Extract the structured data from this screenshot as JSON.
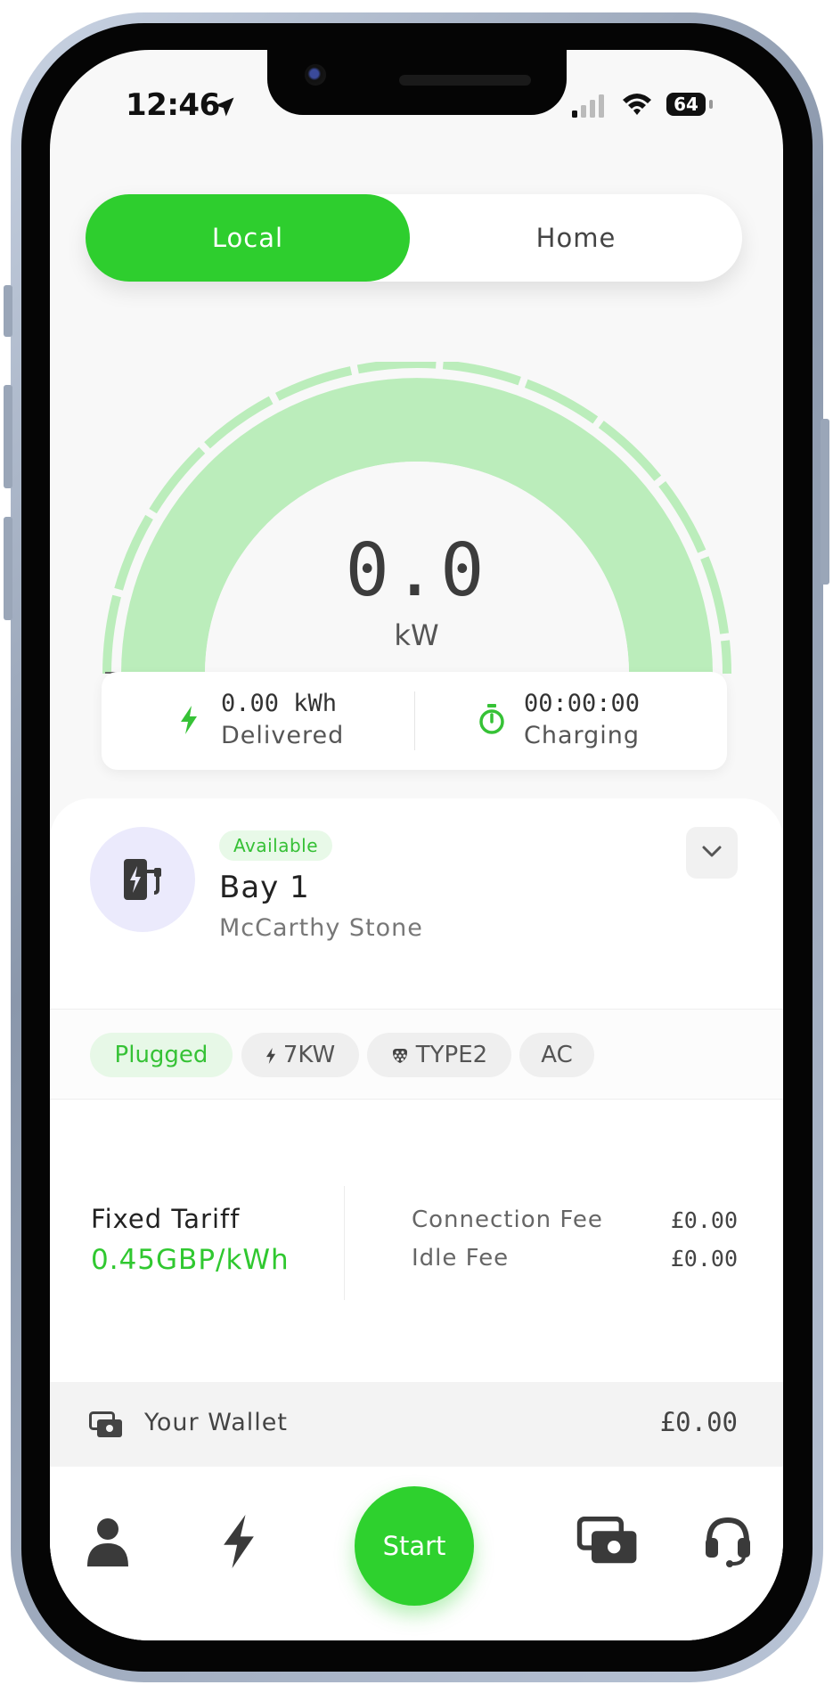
{
  "status_bar": {
    "time": "12:46",
    "battery": "64"
  },
  "mode_toggle": {
    "options": [
      "Local",
      "Home"
    ],
    "selected": "Local"
  },
  "gauge": {
    "power_value": "0.0",
    "power_unit": "kW",
    "fill_fraction": 0
  },
  "stats": {
    "energy_value": "0.00 kWh",
    "energy_label": "Delivered",
    "timer_value": "00:00:00",
    "timer_label": "Charging"
  },
  "charger": {
    "status_badge": "Available",
    "bay_name": "Bay 1",
    "site_name": "McCarthy Stone",
    "chips": [
      "Plugged",
      "7KW",
      "TYPE2",
      "AC"
    ]
  },
  "tariff": {
    "name": "Fixed Tariff",
    "rate": "0.45GBP/kWh",
    "connection_fee_label": "Connection Fee",
    "connection_fee_value": "£0.00",
    "idle_fee_label": "Idle Fee",
    "idle_fee_value": "£0.00"
  },
  "wallet": {
    "label": "Your Wallet",
    "amount": "£0.00"
  },
  "bottom_nav": {
    "start_label": "Start"
  },
  "colors": {
    "accent": "#2ece2e",
    "gauge_fill": "#bbedbb",
    "avatar_bg": "#ebeafc"
  },
  "icons": [
    "location-arrow-icon",
    "signal-icon",
    "wifi-icon",
    "battery-icon",
    "bolt-icon",
    "stopwatch-icon",
    "ev-station-icon",
    "chevron-down-icon",
    "plug-type2-icon",
    "wallet-icon",
    "user-icon",
    "charge-icon",
    "headset-icon"
  ]
}
